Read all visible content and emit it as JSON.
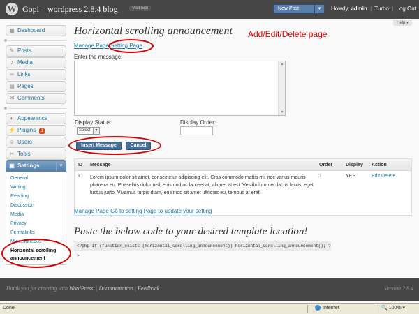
{
  "header": {
    "site_title": "Gopi – wordpress 2.8.4 blog",
    "visit_site": "Visit Site",
    "favorite_action": "New Post",
    "howdy": "Howdy,",
    "user": "admin",
    "sep": "|",
    "turbo": "Turbo",
    "logout": "Log Out"
  },
  "help_label": "Help ▾",
  "menu": {
    "dashboard": "Dashboard",
    "posts": "Posts",
    "media": "Media",
    "links": "Links",
    "pages": "Pages",
    "comments": "Comments",
    "appearance": "Appearance",
    "plugins": "Plugins",
    "plugin_count": "1",
    "users": "Users",
    "tools": "Tools",
    "settings": "Settings",
    "settings_sub": [
      "General",
      "Writing",
      "Reading",
      "Discussion",
      "Media",
      "Privacy",
      "Permalinks",
      "Miscellaneous",
      "Horizontal scrolling announcement"
    ]
  },
  "page": {
    "title": "Horizontal scrolling announcement",
    "annotation": "Add/Edit/Delete page",
    "manage_page": "Manage Page",
    "setting_page": "Setting Page",
    "message_label": "Enter the message:",
    "message_value": "",
    "status_label": "Display Status:",
    "status_value": "Select",
    "order_label": "Display Order:",
    "order_value": "",
    "insert_button": "Insert Message",
    "cancel_button": "Cancel"
  },
  "table": {
    "headers": [
      "ID",
      "Message",
      "Order",
      "Display",
      "Action"
    ],
    "rows": [
      {
        "id": "1",
        "message": "Lorem ipsum dolor sit amet, consectetur adipiscing elit. Cras commodo mattis mi, nec varius mauris pharetra eu. Phasellus dolor nisl, euismod ac laoreet at, aliquet at est. Vestibulum nec lacus lacus, eget luctus justo. Vivamus turpis diam, euismod sit amet ultricies eu, tempus at erat.",
        "order": "1",
        "display": "YES",
        "edit": "Edit",
        "delete": "Delete"
      }
    ]
  },
  "bottom": {
    "manage_page": "Manage Page",
    "goto_setting": "Go to setting Page to update your setting",
    "paste_heading": "Paste the below code to your desired template location!",
    "code": "<?php if (function_exists (horizontal_scrolling_announcement)) horizontal_scrolling_announcement(); ?>"
  },
  "footer": {
    "thanks": "Thank you for creating with",
    "wordpress": "WordPress",
    "documentation": "Documentation",
    "feedback": "Feedback",
    "version": "Version 2.8.4"
  },
  "statusbar": {
    "done": "Done",
    "zone": "Internet",
    "zoom": "100%"
  },
  "colors": {
    "header_bg": "#464646",
    "link": "#21759b",
    "button": "#466e99",
    "annotation": "#d50000"
  }
}
